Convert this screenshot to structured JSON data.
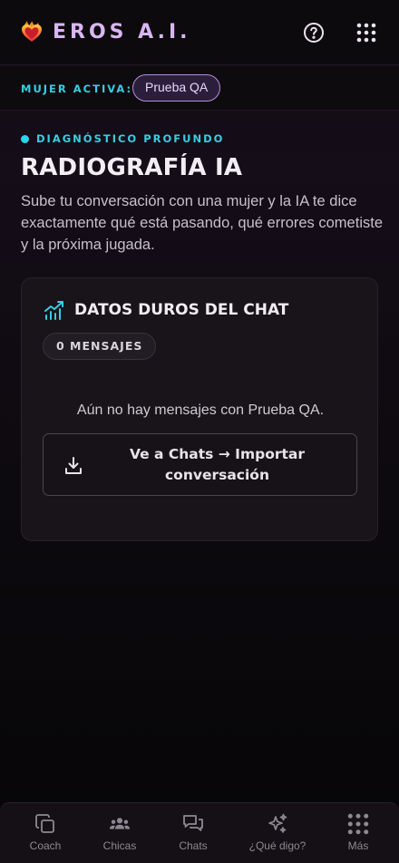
{
  "header": {
    "app_name": "EROS A.I.",
    "brand_icon": "flaming-heart-icon",
    "help_icon": "help-circle-icon",
    "menu_icon": "apps-grid-icon"
  },
  "active_bar": {
    "label": "MUJER ACTIVA:",
    "active_woman": "Prueba QA"
  },
  "section": {
    "eyebrow": "DIAGNÓSTICO PROFUNDO",
    "title": "RADIOGRAFÍA IA",
    "description": "Sube tu conversación con una mujer y la IA te dice exactamente qué está pasando, qué errores cometiste y la próxima jugada."
  },
  "card": {
    "icon": "chart-trend-icon",
    "title": "DATOS DUROS DEL CHAT",
    "message_count": "0 MENSAJES",
    "empty_message": "Aún no hay mensajes con Prueba QA.",
    "import_button": "Ve a Chats → Importar conversación",
    "import_icon": "download-icon"
  },
  "bottom_nav": {
    "items": [
      {
        "label": "Coach",
        "icon": "copy-layers-icon"
      },
      {
        "label": "Chicas",
        "icon": "group-icon"
      },
      {
        "label": "Chats",
        "icon": "chat-bubbles-icon"
      },
      {
        "label": "¿Qué digo?",
        "icon": "sparkles-icon"
      },
      {
        "label": "Más",
        "icon": "apps-grid-icon"
      }
    ]
  },
  "colors": {
    "accent_cyan": "#38cde3",
    "accent_purple": "#b48fe0",
    "brand_text": "#d9b6f2"
  }
}
